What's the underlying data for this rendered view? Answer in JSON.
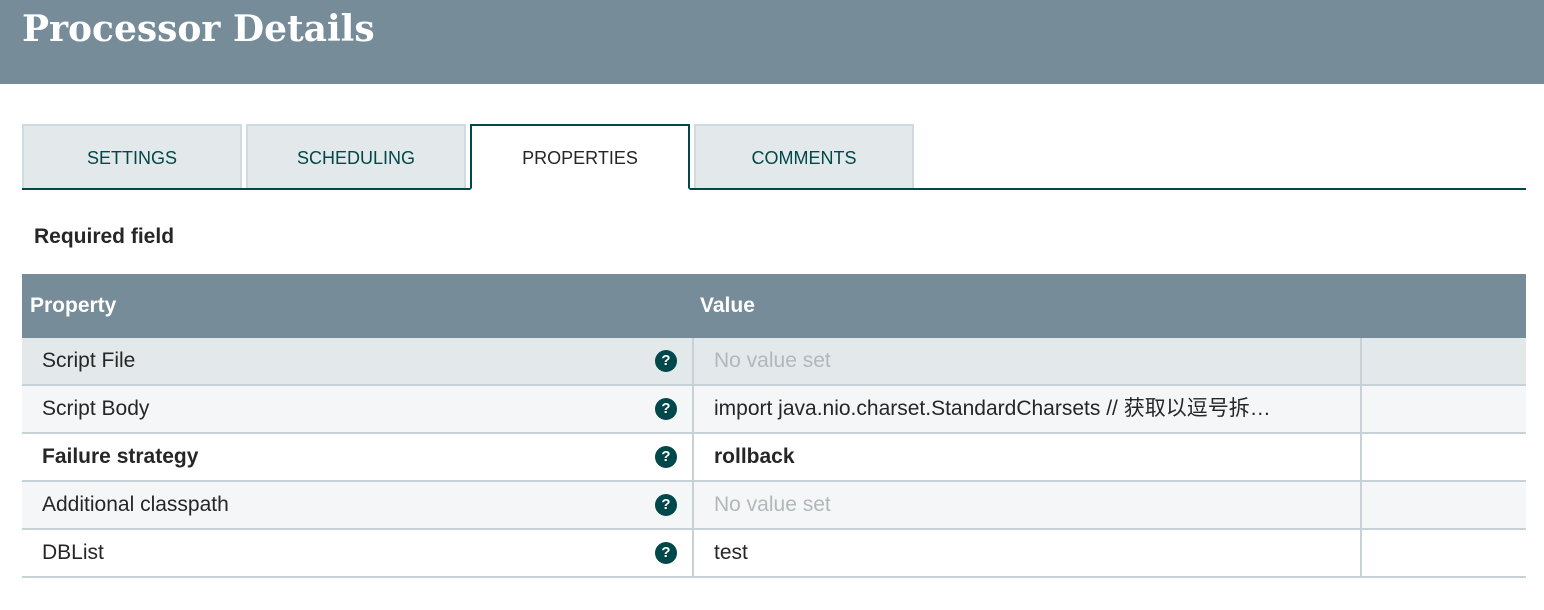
{
  "header": {
    "title": "Processor Details"
  },
  "tabs": [
    {
      "label": "SETTINGS",
      "active": false
    },
    {
      "label": "SCHEDULING",
      "active": false
    },
    {
      "label": "PROPERTIES",
      "active": true
    },
    {
      "label": "COMMENTS",
      "active": false
    }
  ],
  "required_field_label": "Required field",
  "table": {
    "columns": {
      "property": "Property",
      "value": "Value"
    },
    "rows": [
      {
        "property": "Script File",
        "value": "No value set",
        "required": false,
        "unset": true,
        "help_icon": "question-circle-icon"
      },
      {
        "property": "Script Body",
        "value": "import java.nio.charset.StandardCharsets // 获取以逗号拆…",
        "required": false,
        "unset": false,
        "help_icon": "question-circle-icon"
      },
      {
        "property": "Failure strategy",
        "value": "rollback",
        "required": true,
        "unset": false,
        "help_icon": "question-circle-icon"
      },
      {
        "property": "Additional classpath",
        "value": "No value set",
        "required": false,
        "unset": true,
        "help_icon": "question-circle-icon"
      },
      {
        "property": "DBList",
        "value": "test",
        "required": false,
        "unset": false,
        "help_icon": "question-circle-icon"
      }
    ]
  },
  "colors": {
    "header_bg": "#778c99",
    "accent": "#004849",
    "tab_bg": "#e3e8eb",
    "unset_text": "#b0b8bc"
  }
}
